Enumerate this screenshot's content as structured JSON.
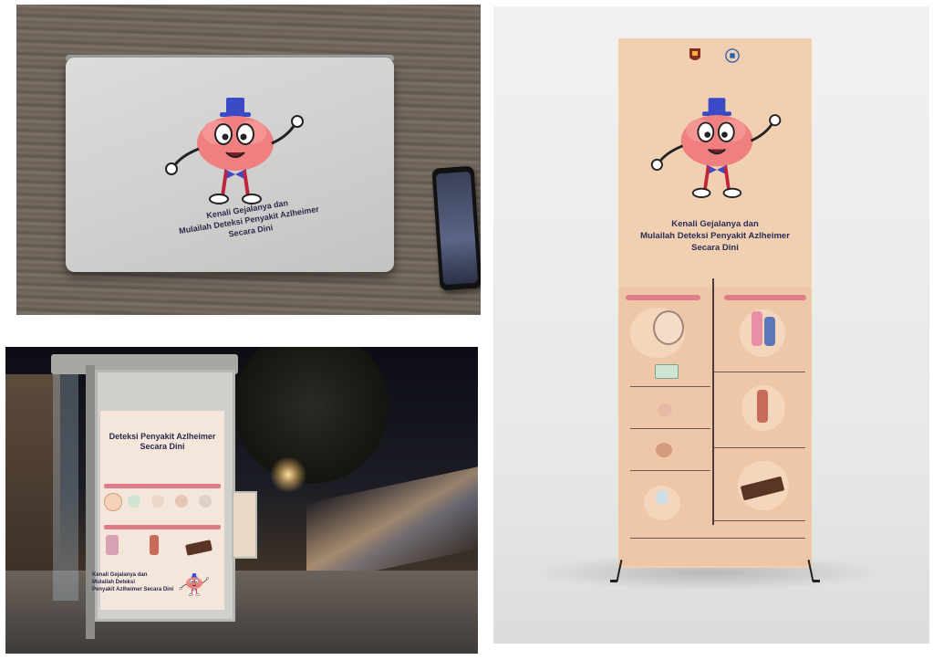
{
  "laptop": {
    "caption_line1": "Kenali Gejalanya dan",
    "caption_line2": "Mulailah Deteksi Penyakit Azlheimer",
    "caption_line3": "Secara Dini"
  },
  "busstop": {
    "title_line1": "Deteksi Penyakit Azlheimer",
    "title_line2": "Secara Dini",
    "foot_line1": "Kenali Gejalanya dan",
    "foot_line2": "Mulailah Deteksi",
    "foot_line3": "Penyakit Azlheimer Secara Dini"
  },
  "banner": {
    "title_line1": "Kenali Gejalanya dan",
    "title_line2": "Mulailah Deteksi Penyakit Azlheimer",
    "title_line3": "Secara Dini"
  },
  "colors": {
    "mascot_brain": "#f08080",
    "mascot_hat": "#3b4bc8",
    "accent_pink": "#e07c88",
    "banner_peach": "#f1cfb1",
    "text_navy": "#2b2e55"
  }
}
